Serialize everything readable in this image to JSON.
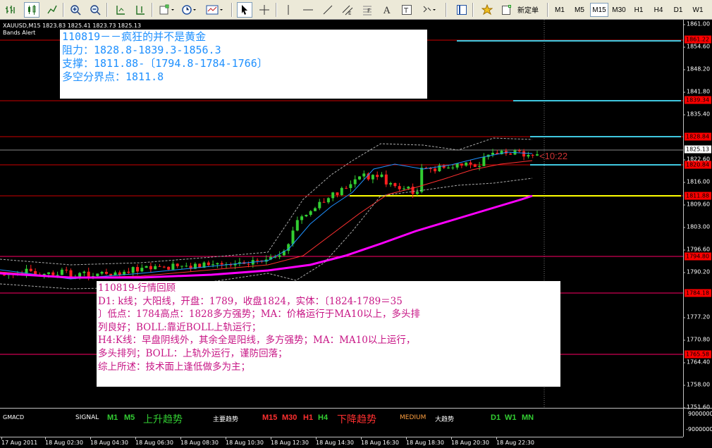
{
  "toolbar": {
    "timeframes": [
      "M1",
      "M5",
      "M15",
      "M30",
      "H1",
      "H4",
      "D1",
      "W1"
    ],
    "active_timeframe": "M15",
    "new_order_label": "新定单"
  },
  "chart": {
    "symbol_info": "XAUUSD,M15  1823.83 1825.41 1823.73 1825.13",
    "indicator_name": "Bands Alert",
    "countdown": "<10:22",
    "price_ticks": [
      "1861.00",
      "1854.60",
      "1848.20",
      "1841.80",
      "1835.40",
      "1822.60",
      "1816.00",
      "1809.60",
      "1803.00",
      "1796.60",
      "1790.20",
      "1777.20",
      "1770.80",
      "1764.40",
      "1758.00",
      "1751.60"
    ],
    "price_labels": [
      {
        "text": "1861.22",
        "style": "red"
      },
      {
        "text": "1839.34",
        "style": "red"
      },
      {
        "text": "1828.84",
        "style": "red"
      },
      {
        "text": "1825.13",
        "style": "light"
      },
      {
        "text": "1820.84",
        "style": "red"
      },
      {
        "text": "1811.88",
        "style": "red"
      },
      {
        "text": "1794.80",
        "style": "red"
      },
      {
        "text": "1784.18",
        "style": "red"
      },
      {
        "text": "1765.58",
        "style": "red"
      }
    ],
    "time_ticks": [
      "17 Aug 2011",
      "18 Aug 02:30",
      "18 Aug 04:30",
      "18 Aug 06:30",
      "18 Aug 08:30",
      "18 Aug 10:30",
      "18 Aug 12:30",
      "18 Aug 14:30",
      "18 Aug 16:30",
      "18 Aug 18:30",
      "18 Aug 20:30",
      "18 Aug 22:30"
    ],
    "colors": {
      "resistance": "#ff0000",
      "support": "#ff0000",
      "pivot": "#ffff00",
      "ma_fast": "#1e90ff",
      "ma_mid": "#ff3030",
      "ma_slow": "#ff00ff",
      "bull": "#32cd32",
      "bear": "#ff2020"
    }
  },
  "note_top": {
    "lines": [
      "110819－－疯狂的并不是黄金",
      "阻力：1828.8-1839.3-1856.3",
      "支撑：1811.88-〔1794.8-1784-1766〕",
      "多空分界点：1811.8"
    ]
  },
  "note_bottom": {
    "lines": [
      "110819-行情回顾",
      "D1: k线；大阳线，开盘：1789，收盘1824，实体：〔1824-1789＝35",
      "〕低点：1784高点：1828多方强势；MA：价格运行于MA10以上，多头排",
      "列良好；BOLL:靠近BOLL上轨运行；",
      "H4:K线：早盘阴线外，其余全是阳线，多方强势；MA：MA10以上运行，",
      "多头排列；BOLL：上轨外运行，谨防回落；",
      "综上所述：技术面上逢低做多为主；"
    ]
  },
  "subwindow": {
    "name": "GMACD",
    "signal": "SIGNAL",
    "tf_low": [
      "M1",
      "M5"
    ],
    "trend_up": "上升趋势",
    "main_trend": "主要趋势",
    "tf_mid": [
      "M15",
      "M30",
      "H1",
      "H4"
    ],
    "trend_down": "下降趋势",
    "medium": "MEDIUM",
    "big_trend": "大趋势",
    "tf_high": [
      "D1",
      "W1",
      "MN"
    ],
    "axis_value": "-9000000",
    "axis_top": "9000000"
  }
}
